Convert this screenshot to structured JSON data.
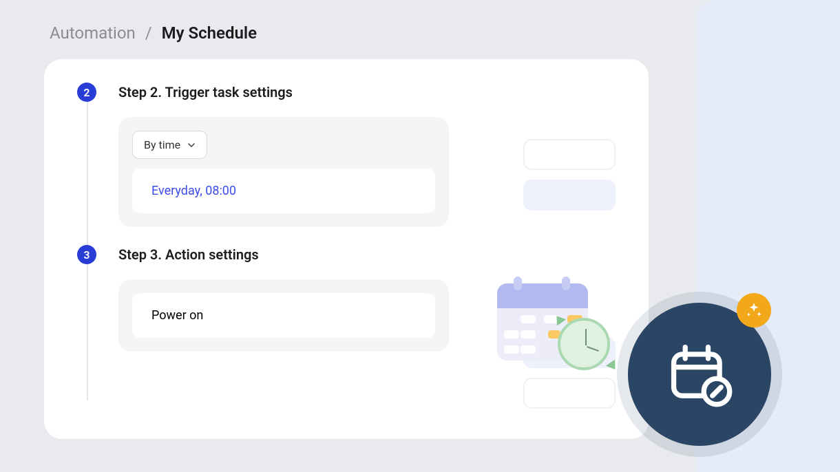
{
  "breadcrumb": {
    "parent": "Automation",
    "separator": "/",
    "current": "My Schedule"
  },
  "steps": [
    {
      "number": "2",
      "title": "Step 2. Trigger task settings",
      "trigger_type": "By time",
      "schedule_text": "Everyday,  08:00"
    },
    {
      "number": "3",
      "title": "Step 3. Action settings",
      "action_text": "Power on"
    }
  ],
  "icons": {
    "chevron_down": "chevron-down-icon",
    "calendar_clock": "calendar-clock-icon",
    "schedule_fab": "schedule-edit-icon",
    "sparkle": "sparkle-icon"
  },
  "colors": {
    "step_badge": "#2a3cd6",
    "accent_text": "#3b4be9",
    "fab_bg": "#2b4564",
    "sparkle_bg": "#f3a81a"
  }
}
